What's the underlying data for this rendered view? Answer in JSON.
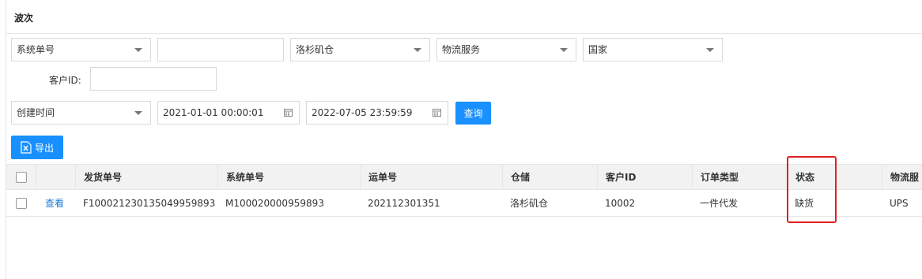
{
  "panel": {
    "title": "波次"
  },
  "filters": {
    "row1": {
      "number_type": "系统单号",
      "number_value": "",
      "warehouse": "洛杉矶仓",
      "logistics_placeholder": "物流服务",
      "country_placeholder": "国家"
    },
    "customer": {
      "label": "客户ID:",
      "value": ""
    },
    "row2": {
      "time_type": "创建时间",
      "start_time": "2021-01-01 00:00:01",
      "end_time": "2022-07-05 23:59:59",
      "query_label": "查询"
    }
  },
  "toolbar": {
    "export_label": "导出"
  },
  "table": {
    "columns": [
      "",
      "",
      "发货单号",
      "系统单号",
      "运单号",
      "仓储",
      "客户ID",
      "订单类型",
      "状态",
      "物流服"
    ],
    "rows": [
      {
        "action": "查看",
        "shipment_no": "F100021230135049959893",
        "system_no": "M100020000959893",
        "tracking_no": "202112301351",
        "warehouse": "洛杉矶仓",
        "customer_id": "10002",
        "order_type": "一件代发",
        "status": "缺货",
        "logistics": "UPS"
      }
    ]
  },
  "colors": {
    "primary": "#1890ff",
    "highlight": "#e02020",
    "link": "#1e7bd6"
  }
}
